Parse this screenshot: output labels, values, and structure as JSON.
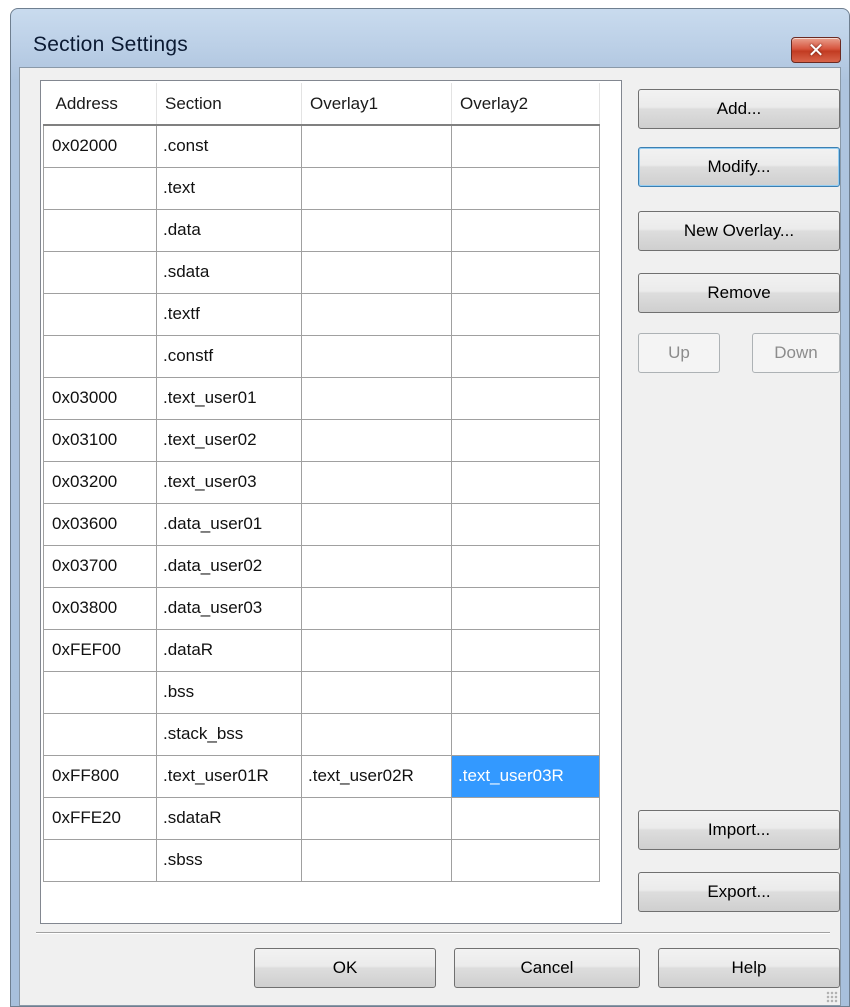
{
  "window": {
    "title": "Section Settings",
    "close_glyph": "✕"
  },
  "grid": {
    "columns": [
      "Address",
      "Section",
      "Overlay1",
      "Overlay2"
    ],
    "rows": [
      {
        "address": "0x02000",
        "section": ".const",
        "overlay1": "",
        "overlay2": ""
      },
      {
        "address": "",
        "section": ".text",
        "overlay1": "",
        "overlay2": ""
      },
      {
        "address": "",
        "section": ".data",
        "overlay1": "",
        "overlay2": ""
      },
      {
        "address": "",
        "section": ".sdata",
        "overlay1": "",
        "overlay2": ""
      },
      {
        "address": "",
        "section": ".textf",
        "overlay1": "",
        "overlay2": ""
      },
      {
        "address": "",
        "section": ".constf",
        "overlay1": "",
        "overlay2": ""
      },
      {
        "address": "0x03000",
        "section": ".text_user01",
        "overlay1": "",
        "overlay2": ""
      },
      {
        "address": "0x03100",
        "section": ".text_user02",
        "overlay1": "",
        "overlay2": ""
      },
      {
        "address": "0x03200",
        "section": ".text_user03",
        "overlay1": "",
        "overlay2": ""
      },
      {
        "address": "0x03600",
        "section": ".data_user01",
        "overlay1": "",
        "overlay2": ""
      },
      {
        "address": "0x03700",
        "section": ".data_user02",
        "overlay1": "",
        "overlay2": ""
      },
      {
        "address": "0x03800",
        "section": ".data_user03",
        "overlay1": "",
        "overlay2": ""
      },
      {
        "address": "0xFEF00",
        "section": ".dataR",
        "overlay1": "",
        "overlay2": ""
      },
      {
        "address": "",
        "section": ".bss",
        "overlay1": "",
        "overlay2": ""
      },
      {
        "address": "",
        "section": ".stack_bss",
        "overlay1": "",
        "overlay2": ""
      },
      {
        "address": "0xFF800",
        "section": ".text_user01R",
        "overlay1": ".text_user02R",
        "overlay2": ".text_user03R"
      },
      {
        "address": "0xFFE20",
        "section": ".sdataR",
        "overlay1": "",
        "overlay2": ""
      },
      {
        "address": "",
        "section": ".sbss",
        "overlay1": "",
        "overlay2": ""
      }
    ],
    "selected_cell": {
      "row": 15,
      "column": "overlay2"
    }
  },
  "buttons": {
    "add": {
      "label": "Add...",
      "enabled": true
    },
    "modify": {
      "label": "Modify...",
      "enabled": true,
      "default": true
    },
    "new_overlay": {
      "label": "New Overlay...",
      "enabled": true
    },
    "remove": {
      "label": "Remove",
      "enabled": true
    },
    "up": {
      "label": "Up",
      "enabled": false
    },
    "down": {
      "label": "Down",
      "enabled": false
    },
    "import": {
      "label": "Import...",
      "enabled": true
    },
    "export": {
      "label": "Export...",
      "enabled": true
    },
    "ok": {
      "label": "OK",
      "enabled": true
    },
    "cancel": {
      "label": "Cancel",
      "enabled": true
    },
    "help": {
      "label": "Help",
      "enabled": true
    }
  },
  "colors": {
    "selection": "#3399ff",
    "close_button": "#c23b22"
  }
}
